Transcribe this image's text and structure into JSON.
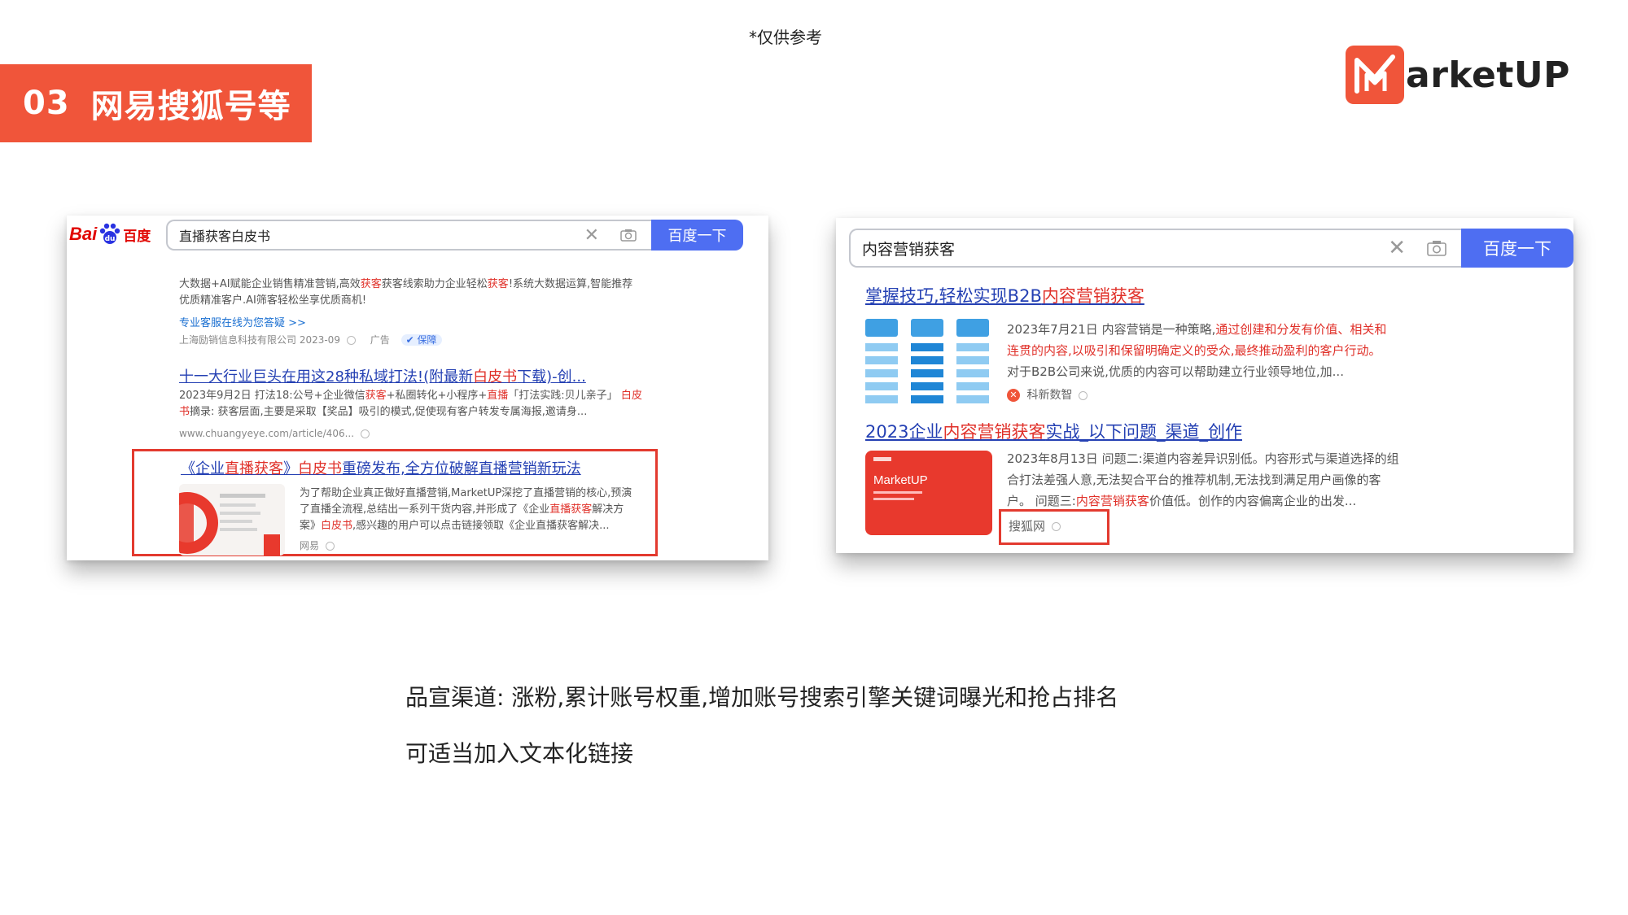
{
  "note": "*仅供参考",
  "section": {
    "number": "03",
    "title": "网易搜狐号等"
  },
  "brand": {
    "logo_text": "arketUP",
    "accent": "#f0553a"
  },
  "left_card": {
    "logo": {
      "bai": "Bai",
      "du": "百度"
    },
    "query": "直播获客白皮书",
    "search_button": "百度一下",
    "ad": {
      "line1_a": "大数据+AI赋能企业销售精准营销,高效",
      "line1_b": "获客",
      "line1_c": "获客线索助力企业轻松",
      "line1_d": "获客",
      "line1_e": "!系统大数据运算,智能推荐",
      "line2": "优质精准客户.AI筛客轻松坐享优质商机!",
      "service_link": "专业客服在线为您答疑 >>",
      "source": "上海励销信息科技有限公司 2023-09",
      "ad_label": "广告",
      "badge": "保障"
    },
    "result2": {
      "title_a": "十一大行业巨头在用这28种私域打法!(附最新",
      "title_b": "白皮书",
      "title_c": "下载)-创...",
      "line1_a": "2023年9月2日 打法18:公号+企业微信",
      "line1_b": "获客",
      "line1_c": "+私圈转化+小程序+",
      "line1_d": "直播",
      "line1_e": "「打法实践:贝儿亲子」",
      "line1_f": "白皮",
      "line2_a": "书",
      "line2_b": "摘录: 获客层面,主要是采取【奖品】吸引的模式,促使现有客户转发专属海报,邀请身...",
      "url": "www.chuangyeye.com/article/406..."
    },
    "result3": {
      "title_a": "《企业",
      "title_b": "直播获客",
      "title_c": "》",
      "title_d": "白皮书",
      "title_e": "重磅发布,全方位破解直播营销新玩法",
      "line1": "为了帮助企业真正做好直播营销,MarketUP深挖了直播营销的核心,预演",
      "line2_a": "了直播全流程,总结出一系列干货内容,并形成了《企业",
      "line2_b": "直播获客",
      "line2_c": "解决方",
      "line3_a": "案》",
      "line3_b": "白皮书",
      "line3_c": ",感兴趣的用户可以点击链接领取《企业直播获客解决...",
      "source": "网易"
    }
  },
  "right_card": {
    "query": "内容营销获客",
    "search_button": "百度一下",
    "result1": {
      "title_a": "掌握技巧,轻松实现B2B",
      "title_b": "内容营销获客",
      "line1_a": "2023年7月21日 内容营销是一种策略,",
      "line1_b": "通过创建和分发有价值、相关和",
      "line2": "连贯的内容,以吸引和保留明确定义的受众,最终推动盈利的客户行动。",
      "line3": "对于B2B公司来说,优质的内容可以帮助建立行业领导地位,加...",
      "source": "科新数智"
    },
    "result2": {
      "title_a": "2023企业",
      "title_b": "内容营销获客",
      "title_c": "实战_以下问题_渠道_创作",
      "line1": "2023年8月13日 问题二:渠道内容差异识别低。内容形式与渠道选择的组",
      "line2": "合打法差强人意,无法契合平台的推荐机制,无法找到满足用户画像的客",
      "line3_a": "户。 问题三:",
      "line3_b": "内容营销获客",
      "line3_c": "价值低。创作的内容偏离企业的出发...",
      "source": "搜狐网",
      "thumb_text": "MarketUP"
    }
  },
  "captions": {
    "line1": "品宣渠道:  涨粉,累计账号权重,增加账号搜索引擎关键词曝光和抢占排名",
    "line2": "可适当加入文本化链接"
  }
}
